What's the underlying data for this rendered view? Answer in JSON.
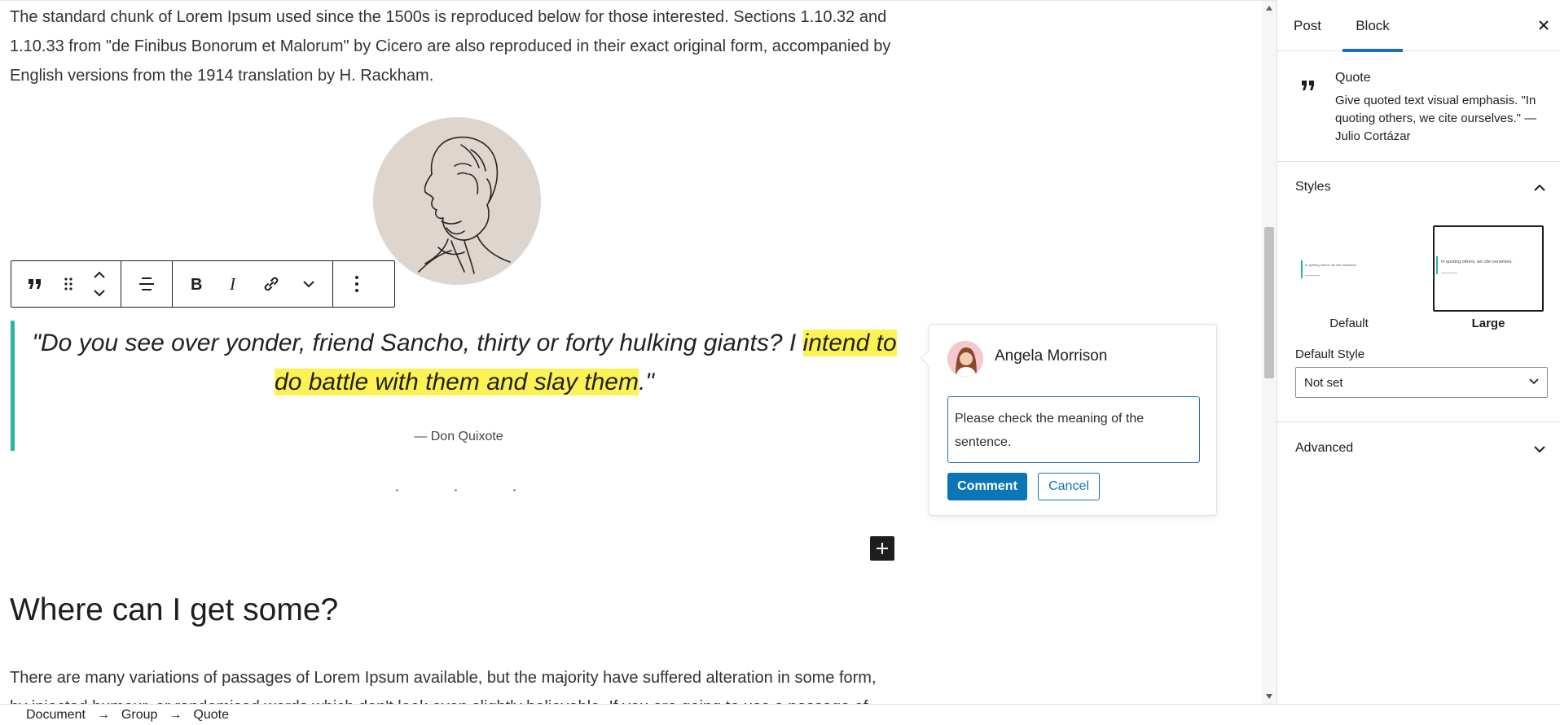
{
  "editor": {
    "intro_paragraph": "The standard chunk of Lorem Ipsum used since the 1500s is reproduced below for those interested. Sections 1.10.32 and 1.10.33 from \"de Finibus Bonorum et Malorum\" by Cicero are also reproduced in their exact original form, accompanied by English versions from the 1914 translation by H. Rackham.",
    "quote": {
      "text_before": "\"Do you see over yonder, friend Sancho, thirty or forty hulking giants? I ",
      "text_highlighted": "intend to do battle with them and slay them",
      "text_after": ".\"",
      "citation": "— Don Quixote",
      "accent_color": "#28b5a8",
      "highlight_color": "#fdf254"
    },
    "heading": "Where can I get some?",
    "bottom_paragraph": "There are many variations of passages of Lorem Ipsum available, but the majority have suffered alteration in some form, by injected humour, or randomised words which don't look even slightly believable. If you are going to use a passage of Lorem"
  },
  "toolbar": {
    "buttons": [
      "quote-icon",
      "drag-handle-icon",
      "move-up-down-icon",
      "align-icon",
      "bold-icon",
      "italic-icon",
      "link-icon",
      "more-options-chevron-icon",
      "kebab-menu-icon"
    ]
  },
  "comment": {
    "author": "Angela Morrison",
    "text": "Please check the meaning of the sentence.",
    "submit_label": "Comment",
    "cancel_label": "Cancel",
    "button_color": "#0a76b8"
  },
  "sidebar": {
    "tabs": [
      "Post",
      "Block"
    ],
    "active_tab": "Block",
    "block_card": {
      "title": "Quote",
      "description": "Give quoted text visual emphasis. \"In quoting others, we cite ourselves.\" — Julio Cortázar"
    },
    "styles": {
      "title": "Styles",
      "options": [
        "Default",
        "Large"
      ],
      "selected": "Large",
      "preview_text": "In quoting others, we cite ourselves.",
      "default_style_label": "Default Style",
      "default_style_value": "Not set"
    },
    "advanced": {
      "title": "Advanced"
    }
  },
  "breadcrumb": {
    "items": [
      "Document",
      "Group",
      "Quote"
    ],
    "separator": "→"
  }
}
